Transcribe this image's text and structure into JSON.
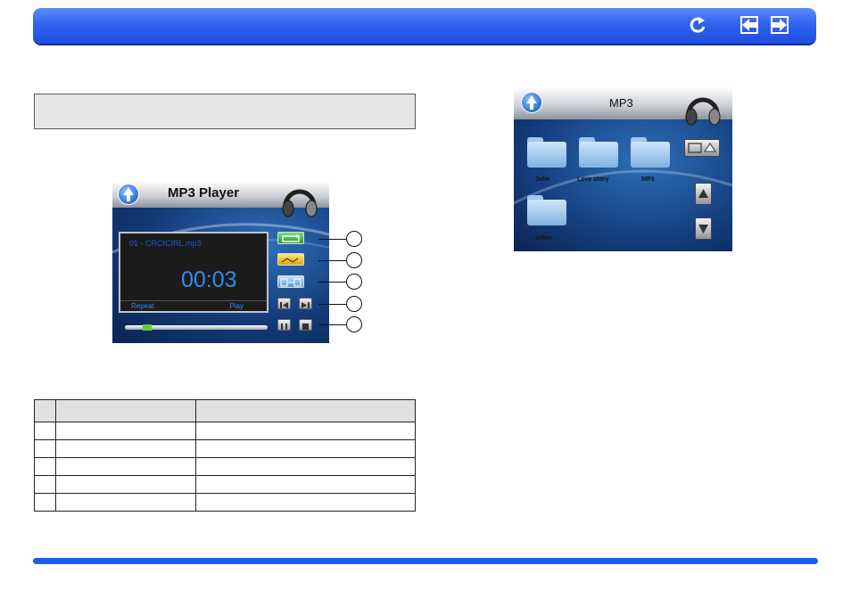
{
  "header": {
    "icons": {
      "back": "return-arrow-icon",
      "prev": "arrow-left-icon",
      "next": "arrow-right-icon"
    },
    "color": "#2f62ee"
  },
  "player_screenshot": {
    "title": "MP3 Player",
    "track_name": "01 - CRCICIRL.mp3",
    "time": "00:03",
    "repeat_label": "Repeat",
    "status_label": "Play",
    "callouts": [
      "",
      "",
      "",
      "",
      ""
    ]
  },
  "table": {
    "headers": [
      "",
      "",
      ""
    ],
    "rows": [
      [
        "",
        "",
        ""
      ],
      [
        "",
        "",
        ""
      ],
      [
        "",
        "",
        ""
      ],
      [
        "",
        "",
        ""
      ],
      [
        "",
        "",
        ""
      ]
    ]
  },
  "browser_screenshot": {
    "title": "MP3",
    "folders": [
      "Jolin",
      "Love story",
      "MP3",
      "video"
    ]
  }
}
